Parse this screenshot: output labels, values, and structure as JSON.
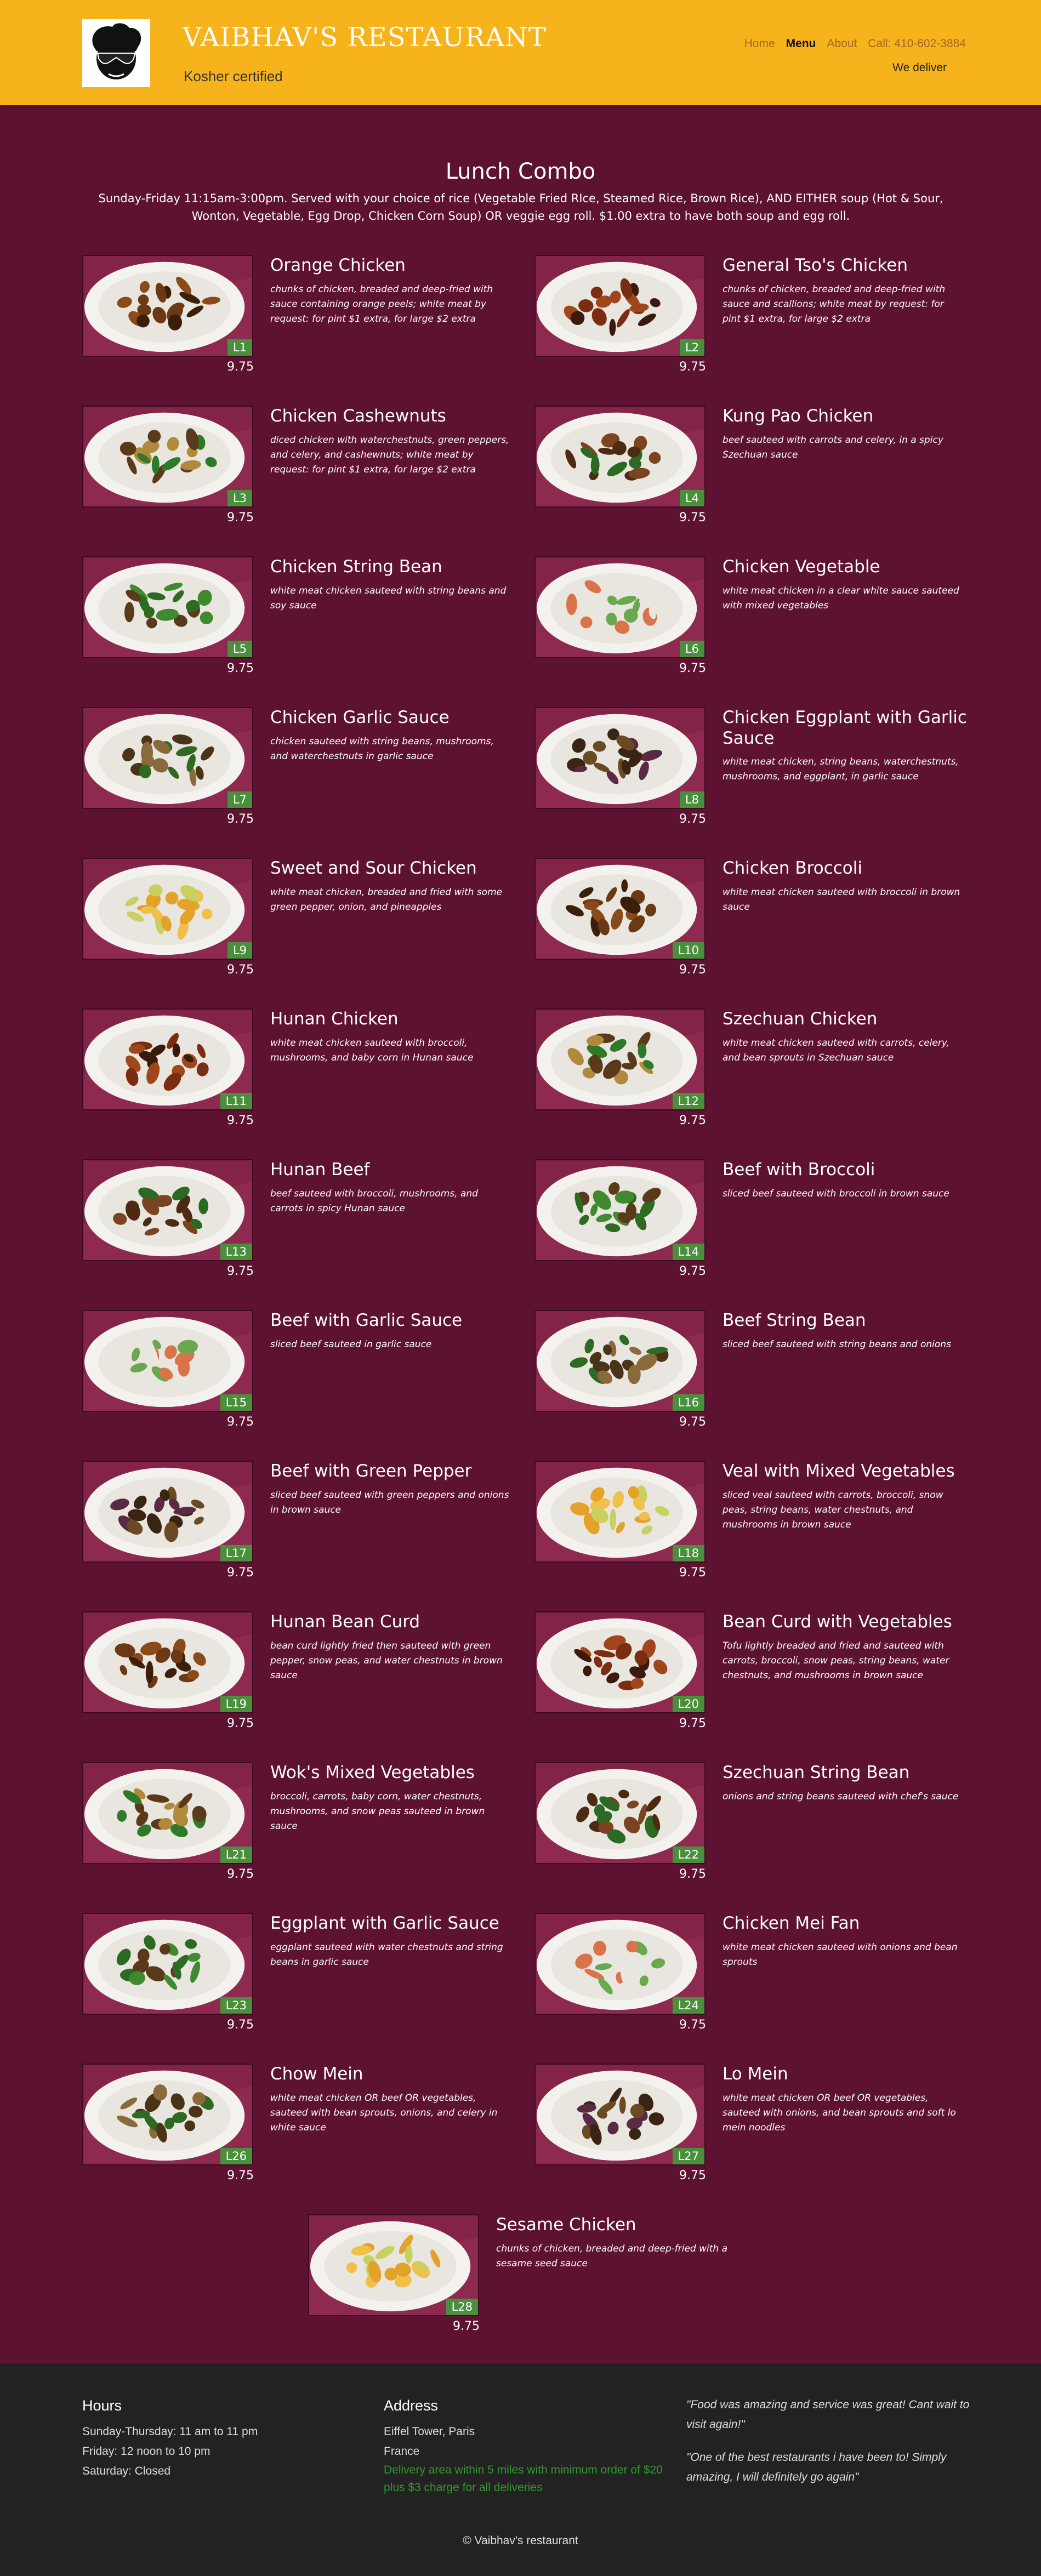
{
  "header": {
    "title": "VAIBHAV'S RESTAURANT",
    "subtitle": "Kosher certified",
    "nav": [
      {
        "label": "Home",
        "active": false
      },
      {
        "label": "Menu",
        "active": true
      },
      {
        "label": "About",
        "active": false
      },
      {
        "label": "Call: 410-602-3884",
        "active": false
      }
    ],
    "deliver": "We deliver"
  },
  "menu": {
    "title": "Lunch Combo",
    "description": "Sunday-Friday 11:15am-3:00pm. Served with your choice of rice (Vegetable Fried RIce, Steamed Rice, Brown Rice), AND EITHER soup (Hot & Sour, Wonton, Vegetable, Egg Drop, Chicken Corn Soup) OR veggie egg roll. $1.00 extra to have both soup and egg roll.",
    "items": [
      {
        "code": "L1",
        "name": "Orange Chicken",
        "desc": "chunks of chicken, breaded and deep-fried with sauce containing orange peels; white meat by request: for pint $1 extra, for large $2 extra",
        "price": "9.75"
      },
      {
        "code": "L2",
        "name": "General Tso's Chicken",
        "desc": "chunks of chicken, breaded and deep-fried with sauce and scallions; white meat by request: for pint $1 extra, for large $2 extra",
        "price": "9.75"
      },
      {
        "code": "L3",
        "name": "Chicken Cashewnuts",
        "desc": "diced chicken with waterchestnuts, green peppers, and celery, and cashewnuts; white meat by request: for pint $1 extra, for large $2 extra",
        "price": "9.75"
      },
      {
        "code": "L4",
        "name": "Kung Pao Chicken",
        "desc": "beef sauteed with carrots and celery, in a spicy Szechuan sauce",
        "price": "9.75"
      },
      {
        "code": "L5",
        "name": "Chicken String Bean",
        "desc": "white meat chicken sauteed with string beans and soy sauce",
        "price": "9.75"
      },
      {
        "code": "L6",
        "name": "Chicken Vegetable",
        "desc": "white meat chicken in a clear white sauce sauteed with mixed vegetables",
        "price": "9.75"
      },
      {
        "code": "L7",
        "name": "Chicken Garlic Sauce",
        "desc": "chicken sauteed with string beans, mushrooms, and waterchestnuts in garlic sauce",
        "price": "9.75"
      },
      {
        "code": "L8",
        "name": "Chicken Eggplant with Garlic Sauce",
        "desc": "white meat chicken, string beans, waterchestnuts, mushrooms, and eggplant, in garlic sauce",
        "price": "9.75"
      },
      {
        "code": "L9",
        "name": "Sweet and Sour Chicken",
        "desc": "white meat chicken, breaded and fried with some green pepper, onion, and pineapples",
        "price": "9.75"
      },
      {
        "code": "L10",
        "name": "Chicken Broccoli",
        "desc": "white meat chicken sauteed with broccoli in brown sauce",
        "price": "9.75"
      },
      {
        "code": "L11",
        "name": "Hunan Chicken",
        "desc": "white meat chicken sauteed with broccoli, mushrooms, and baby corn in Hunan sauce",
        "price": "9.75"
      },
      {
        "code": "L12",
        "name": "Szechuan Chicken",
        "desc": "white meat chicken sauteed with carrots, celery, and bean sprouts in Szechuan sauce",
        "price": "9.75"
      },
      {
        "code": "L13",
        "name": "Hunan Beef",
        "desc": "beef sauteed with broccoli, mushrooms, and carrots in spicy Hunan sauce",
        "price": "9.75"
      },
      {
        "code": "L14",
        "name": "Beef with Broccoli",
        "desc": "sliced beef sauteed with broccoli in brown sauce",
        "price": "9.75"
      },
      {
        "code": "L15",
        "name": "Beef with Garlic Sauce",
        "desc": "sliced beef sauteed in garlic sauce",
        "price": "9.75"
      },
      {
        "code": "L16",
        "name": "Beef String Bean",
        "desc": "sliced beef sauteed with string beans and onions",
        "price": "9.75"
      },
      {
        "code": "L17",
        "name": "Beef with Green Pepper",
        "desc": "sliced beef sauteed with green peppers and onions in brown sauce",
        "price": "9.75"
      },
      {
        "code": "L18",
        "name": "Veal with Mixed Vegetables",
        "desc": "sliced veal sauteed with carrots, broccoli, snow peas, string beans, water chestnuts, and mushrooms in brown sauce",
        "price": "9.75"
      },
      {
        "code": "L19",
        "name": "Hunan Bean Curd",
        "desc": "bean curd lightly fried then sauteed with green pepper, snow peas, and water chestnuts in brown sauce",
        "price": "9.75"
      },
      {
        "code": "L20",
        "name": "Bean Curd with Vegetables",
        "desc": "Tofu lightly breaded and fried and sauteed with carrots, broccoli, snow peas, string beans, water chestnuts, and mushrooms in brown sauce",
        "price": "9.75"
      },
      {
        "code": "L21",
        "name": "Wok's Mixed Vegetables",
        "desc": "broccoli, carrots, baby corn, water chestnuts, mushrooms, and snow peas sauteed in brown sauce",
        "price": "9.75"
      },
      {
        "code": "L22",
        "name": "Szechuan String Bean",
        "desc": "onions and string beans sauteed with chef's sauce",
        "price": "9.75"
      },
      {
        "code": "L23",
        "name": "Eggplant with Garlic Sauce",
        "desc": "eggplant sauteed with water chestnuts and string beans in garlic sauce",
        "price": "9.75"
      },
      {
        "code": "L24",
        "name": "Chicken Mei Fan",
        "desc": "white meat chicken sauteed with onions and bean sprouts",
        "price": "9.75"
      },
      {
        "code": "L26",
        "name": "Chow Mein",
        "desc": "white meat chicken OR beef OR vegetables, sauteed with bean sprouts, onions, and celery in white sauce",
        "price": "9.75"
      },
      {
        "code": "L27",
        "name": "Lo Mein",
        "desc": "white meat chicken OR beef OR vegetables, sauteed with onions, and bean sprouts and soft lo mein noodles",
        "price": "9.75"
      },
      {
        "code": "L28",
        "name": "Sesame Chicken",
        "desc": "chunks of chicken, breaded and deep-fried with a sesame seed sauce",
        "price": "9.75"
      }
    ]
  },
  "footer": {
    "hours": {
      "title": "Hours",
      "lines": [
        "Sunday-Thursday: 11 am to 11 pm",
        "Friday: 12 noon to 10 pm",
        "Saturday: Closed"
      ]
    },
    "address": {
      "title": "Address",
      "lines": [
        "Eiffel Tower, Paris",
        "France"
      ],
      "note": "Delivery area within 5 miles with minimum order of $20 plus $3 charge for all deliveries"
    },
    "reviews": [
      "\"Food was amazing and service was great! Cant wait to visit again!\"",
      "\"One of the best restaurants i have been to! Simply amazing, I will definitely go again\""
    ],
    "copyright": "© Vaibhav's restaurant"
  },
  "colors": {
    "header_bg": "#f7b31b",
    "page_bg": "#5e1232",
    "code_badge": "#4a8f3c",
    "footer_bg": "#222222",
    "delivery_note": "#2f9a2a"
  }
}
